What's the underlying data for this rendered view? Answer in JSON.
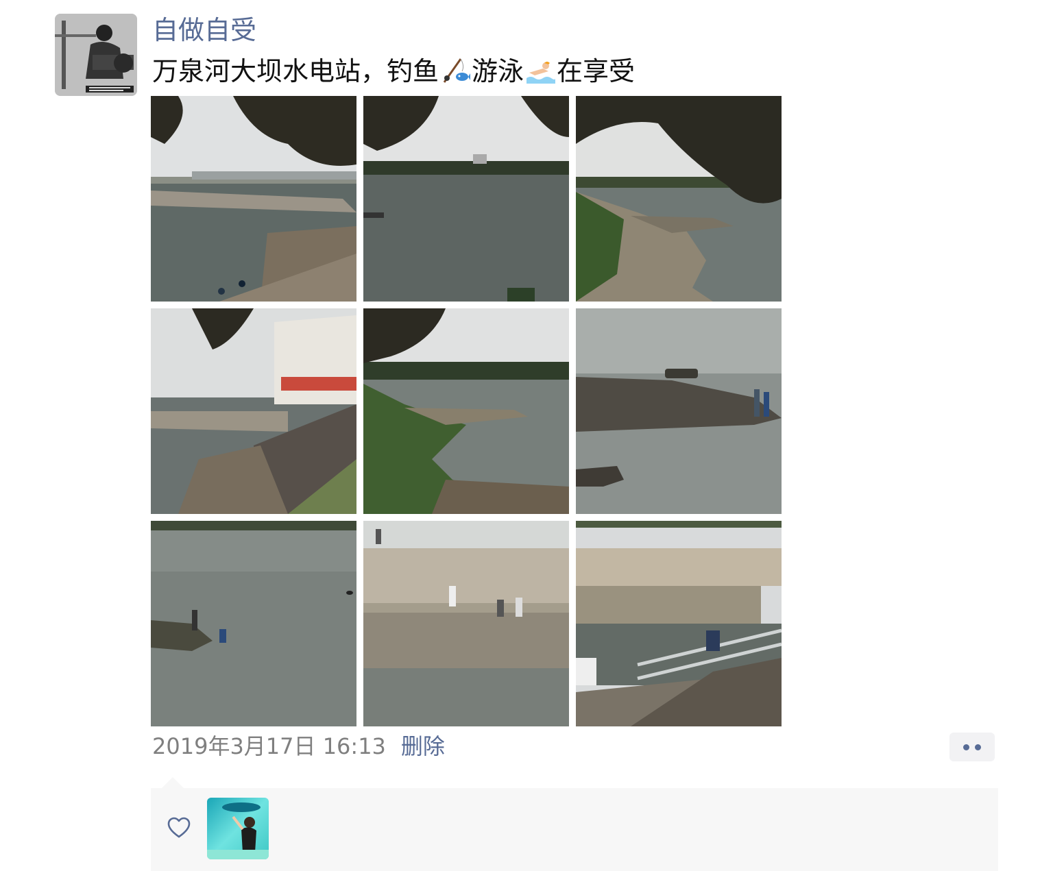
{
  "post": {
    "username": "自做自受",
    "text_part1": "万泉河大坝水电站，钓鱼",
    "text_part2": "游泳",
    "text_part3": "在享受",
    "emoji1": "fishing-pole-icon",
    "emoji2": "swimming-icon",
    "photo_count": 9,
    "timestamp": "2019年3月17日 16:13",
    "delete_label": "删除",
    "more_icon": "more-dots-icon"
  },
  "likes": {
    "icon": "heart-icon"
  },
  "colors": {
    "name_link": "#576b95",
    "timestamp": "#7f7f7f",
    "panel_bg": "#f7f7f7"
  }
}
